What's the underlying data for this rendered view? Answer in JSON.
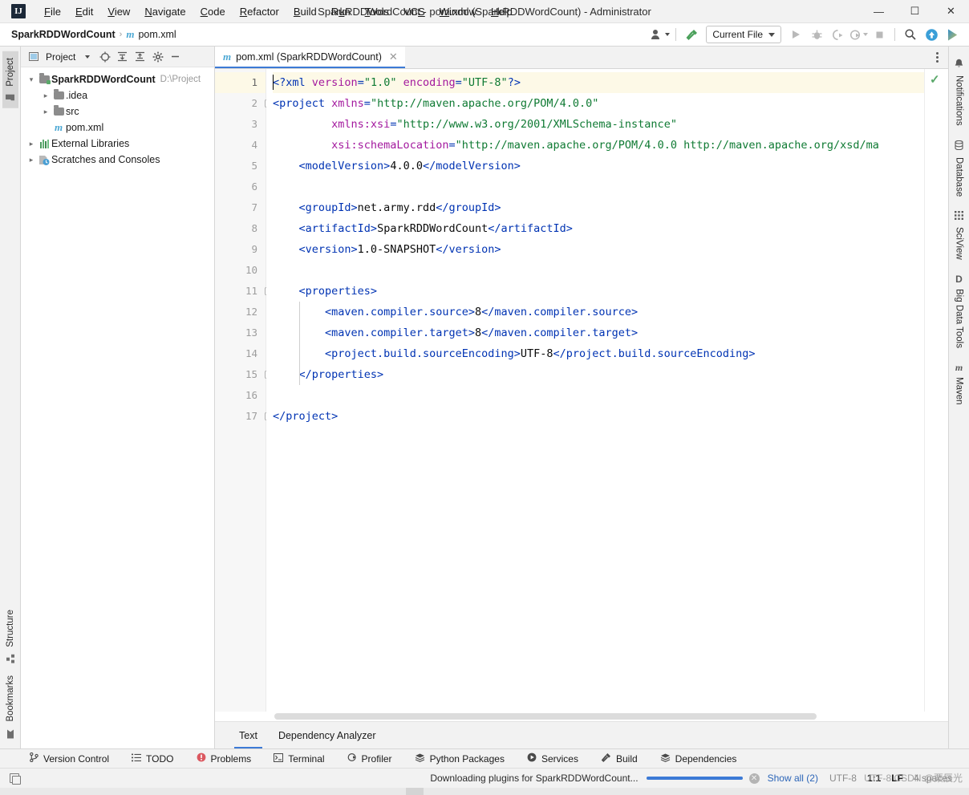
{
  "window": {
    "title": "SparkRDDWordCount - pom.xml (SparkRDDWordCount) - Administrator",
    "logo": "IJ",
    "minimize": "—",
    "maximize": "☐",
    "close": "✕"
  },
  "menu": {
    "items": [
      {
        "label": "File"
      },
      {
        "label": "Edit"
      },
      {
        "label": "View"
      },
      {
        "label": "Navigate"
      },
      {
        "label": "Code"
      },
      {
        "label": "Refactor"
      },
      {
        "label": "Build"
      },
      {
        "label": "Run"
      },
      {
        "label": "Tools"
      },
      {
        "label": "VCS"
      },
      {
        "label": "Window"
      },
      {
        "label": "Help"
      }
    ]
  },
  "navbar": {
    "breadcrumb": [
      {
        "label": "SparkRDDWordCount",
        "icon": ""
      },
      {
        "label": "pom.xml",
        "icon": "maven-icon"
      }
    ],
    "separator": "›",
    "run_config": "Current File",
    "icons": [
      "user-settings-icon",
      "build-hammer-icon",
      "run-icon",
      "debug-icon",
      "run-with-coverage-icon",
      "profile-icon",
      "stop-icon",
      "search-icon",
      "update-project-icon",
      "ide-feature-icon"
    ]
  },
  "left_strip": {
    "top": [
      {
        "label": "Project",
        "icon": "project-folder-icon",
        "active": true
      }
    ],
    "bottom": [
      {
        "label": "Structure",
        "icon": "structure-icon"
      },
      {
        "label": "Bookmarks",
        "icon": "bookmark-icon"
      }
    ]
  },
  "right_strip": {
    "items": [
      {
        "label": "Notifications",
        "icon": "bell-icon"
      },
      {
        "label": "Database",
        "icon": "database-icon"
      },
      {
        "label": "SciView",
        "icon": "sciview-grid-icon"
      },
      {
        "label": "Big Data Tools",
        "icon": "big-data-tools-icon"
      },
      {
        "label": "Maven",
        "icon": "maven-icon"
      }
    ]
  },
  "project_panel": {
    "title": "Project",
    "toolbar_icons": [
      "chevron-down-icon",
      "select-opened-file-icon",
      "expand-all-icon",
      "collapse-all-icon",
      "gear-icon",
      "hide-icon"
    ],
    "tree": [
      {
        "label": "SparkRDDWordCount",
        "path": "D:\\Project",
        "icon": "project-folder-icon",
        "arrow": "⌄",
        "indent": 0,
        "bold": true
      },
      {
        "label": ".idea",
        "path": "",
        "icon": "folder-icon",
        "arrow": "›",
        "indent": 1,
        "bold": false
      },
      {
        "label": "src",
        "path": "",
        "icon": "folder-icon",
        "arrow": "›",
        "indent": 1,
        "bold": false
      },
      {
        "label": "pom.xml",
        "path": "",
        "icon": "maven-icon",
        "arrow": "",
        "indent": 1,
        "bold": false
      },
      {
        "label": "External Libraries",
        "path": "",
        "icon": "libraries-icon",
        "arrow": "›",
        "indent": 0,
        "bold": false
      },
      {
        "label": "Scratches and Consoles",
        "path": "",
        "icon": "scratches-icon",
        "arrow": "›",
        "indent": 0,
        "bold": false
      }
    ]
  },
  "editor": {
    "tab": {
      "label": "pom.xml (SparkRDDWordCount)",
      "icon": "maven-icon",
      "close": "✕"
    },
    "inspection_status": "✓",
    "caret_position": "1:1",
    "lines": [
      {
        "n": "1",
        "fold": false,
        "current": true,
        "tokens": [
          {
            "t": "<?xml ",
            "c": "tag"
          },
          {
            "t": "version",
            "c": "attr"
          },
          {
            "t": "=",
            "c": "punc"
          },
          {
            "t": "\"1.0\"",
            "c": "val"
          },
          {
            "t": " ",
            "c": "txt"
          },
          {
            "t": "encoding",
            "c": "attr"
          },
          {
            "t": "=",
            "c": "punc"
          },
          {
            "t": "\"UTF-8\"",
            "c": "val"
          },
          {
            "t": "?>",
            "c": "tag"
          }
        ]
      },
      {
        "n": "2",
        "fold": true,
        "current": false,
        "tokens": [
          {
            "t": "<project ",
            "c": "tag"
          },
          {
            "t": "xmlns",
            "c": "attr"
          },
          {
            "t": "=",
            "c": "punc"
          },
          {
            "t": "\"http://maven.apache.org/POM/4.0.0\"",
            "c": "val"
          }
        ]
      },
      {
        "n": "3",
        "fold": false,
        "current": false,
        "tokens": [
          {
            "t": "         ",
            "c": "txt"
          },
          {
            "t": "xmlns:xsi",
            "c": "attr"
          },
          {
            "t": "=",
            "c": "punc"
          },
          {
            "t": "\"http://www.w3.org/2001/XMLSchema-instance\"",
            "c": "val"
          }
        ]
      },
      {
        "n": "4",
        "fold": false,
        "current": false,
        "tokens": [
          {
            "t": "         ",
            "c": "txt"
          },
          {
            "t": "xsi:schemaLocation",
            "c": "attr"
          },
          {
            "t": "=",
            "c": "punc"
          },
          {
            "t": "\"http://maven.apache.org/POM/4.0.0 http://maven.apache.org/xsd/ma",
            "c": "val"
          }
        ]
      },
      {
        "n": "5",
        "fold": false,
        "current": false,
        "tokens": [
          {
            "t": "    ",
            "c": "txt"
          },
          {
            "t": "<modelVersion>",
            "c": "tag"
          },
          {
            "t": "4.0.0",
            "c": "txt"
          },
          {
            "t": "</modelVersion>",
            "c": "tag"
          }
        ]
      },
      {
        "n": "6",
        "fold": false,
        "current": false,
        "tokens": []
      },
      {
        "n": "7",
        "fold": false,
        "current": false,
        "tokens": [
          {
            "t": "    ",
            "c": "txt"
          },
          {
            "t": "<groupId>",
            "c": "tag"
          },
          {
            "t": "net.army.rdd",
            "c": "txt"
          },
          {
            "t": "</groupId>",
            "c": "tag"
          }
        ]
      },
      {
        "n": "8",
        "fold": false,
        "current": false,
        "tokens": [
          {
            "t": "    ",
            "c": "txt"
          },
          {
            "t": "<artifactId>",
            "c": "tag"
          },
          {
            "t": "SparkRDDWordCount",
            "c": "txt"
          },
          {
            "t": "</artifactId>",
            "c": "tag"
          }
        ]
      },
      {
        "n": "9",
        "fold": false,
        "current": false,
        "tokens": [
          {
            "t": "    ",
            "c": "txt"
          },
          {
            "t": "<version>",
            "c": "tag"
          },
          {
            "t": "1.0-SNAPSHOT",
            "c": "txt"
          },
          {
            "t": "</version>",
            "c": "tag"
          }
        ]
      },
      {
        "n": "10",
        "fold": false,
        "current": false,
        "tokens": []
      },
      {
        "n": "11",
        "fold": true,
        "current": false,
        "tokens": [
          {
            "t": "    ",
            "c": "txt"
          },
          {
            "t": "<properties>",
            "c": "tag"
          }
        ]
      },
      {
        "n": "12",
        "fold": false,
        "current": false,
        "tokens": [
          {
            "t": "        ",
            "c": "txt"
          },
          {
            "t": "<maven.compiler.source>",
            "c": "tag"
          },
          {
            "t": "8",
            "c": "txt"
          },
          {
            "t": "</maven.compiler.source>",
            "c": "tag"
          }
        ]
      },
      {
        "n": "13",
        "fold": false,
        "current": false,
        "tokens": [
          {
            "t": "        ",
            "c": "txt"
          },
          {
            "t": "<maven.compiler.target>",
            "c": "tag"
          },
          {
            "t": "8",
            "c": "txt"
          },
          {
            "t": "</maven.compiler.target>",
            "c": "tag"
          }
        ]
      },
      {
        "n": "14",
        "fold": false,
        "current": false,
        "tokens": [
          {
            "t": "        ",
            "c": "txt"
          },
          {
            "t": "<project.build.sourceEncoding>",
            "c": "tag"
          },
          {
            "t": "UTF-8",
            "c": "txt"
          },
          {
            "t": "</project.build.sourceEncoding>",
            "c": "tag"
          }
        ]
      },
      {
        "n": "15",
        "fold": true,
        "current": false,
        "tokens": [
          {
            "t": "    ",
            "c": "txt"
          },
          {
            "t": "</properties>",
            "c": "tag"
          }
        ]
      },
      {
        "n": "16",
        "fold": false,
        "current": false,
        "tokens": []
      },
      {
        "n": "17",
        "fold": true,
        "current": false,
        "tokens": [
          {
            "t": "</project>",
            "c": "tag"
          }
        ]
      }
    ],
    "bottom_tabs": [
      {
        "label": "Text",
        "active": true
      },
      {
        "label": "Dependency Analyzer",
        "active": false
      }
    ]
  },
  "tool_windows": [
    {
      "label": "Version Control",
      "icon": "branch-icon"
    },
    {
      "label": "TODO",
      "icon": "list-icon"
    },
    {
      "label": "Problems",
      "icon": "problems-icon"
    },
    {
      "label": "Terminal",
      "icon": "terminal-icon"
    },
    {
      "label": "Profiler",
      "icon": "profiler-icon"
    },
    {
      "label": "Python Packages",
      "icon": "packages-icon"
    },
    {
      "label": "Services",
      "icon": "services-icon"
    },
    {
      "label": "Build",
      "icon": "build-hammer-icon"
    },
    {
      "label": "Dependencies",
      "icon": "dependencies-icon"
    }
  ],
  "statusbar": {
    "progress_text": "Downloading plugins for SparkRDDWordCount...",
    "progress_percent": 100,
    "cancel": "✕",
    "show_all": "Show all (2)",
    "encoding": "UTF-8",
    "caret": "1:1",
    "line_sep": "LF",
    "indent": "4 spaces",
    "watermark": "UTF-8 CSDN @栗辰光"
  },
  "colors": {
    "accent": "#3c7ad6",
    "tag": "#0033b3",
    "attr": "#a3199e",
    "value": "#0f7a33",
    "ok_green": "#59a869",
    "link": "#2c65b8",
    "current_line": "#fdf9e7"
  }
}
